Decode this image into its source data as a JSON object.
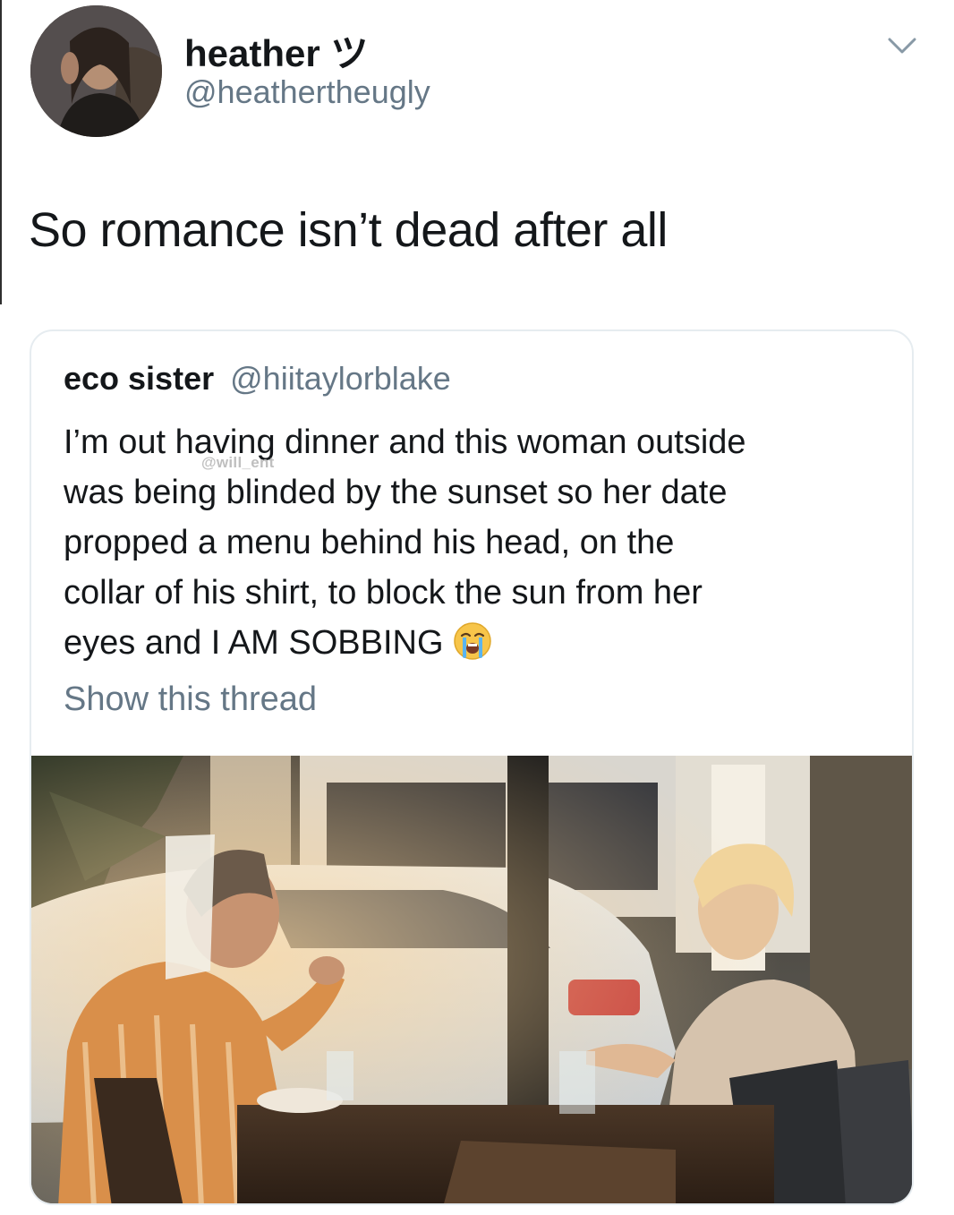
{
  "author": {
    "display_name": "heather ツ",
    "handle": "@heathertheugly"
  },
  "tweet": {
    "text": "So romance isn’t dead after all"
  },
  "quoted_tweet": {
    "display_name": "eco sister",
    "handle": "@hiitaylorblake",
    "lines": [
      "I’m out having dinner and this woman outside",
      "was being blinded by the sunset so her date",
      "propped a menu behind his head, on the",
      "collar of his shirt, to block the sun from her",
      "eyes and I AM SOBBING"
    ],
    "emoji": "loudly-crying-face-emoji",
    "show_thread_label": "Show this thread",
    "watermark": "@will_ent"
  },
  "icons": {
    "menu": "chevron-down-icon"
  },
  "colors": {
    "text_primary": "#14171a",
    "text_secondary": "#657786",
    "card_border": "#e6ecf0"
  }
}
